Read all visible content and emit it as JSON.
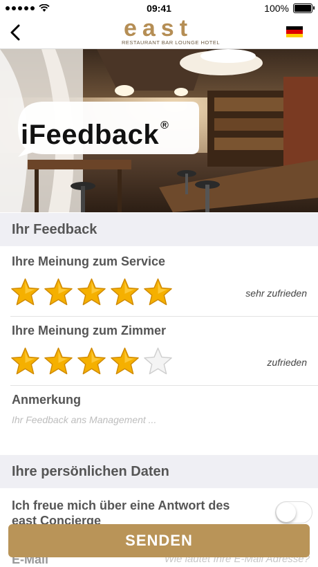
{
  "status": {
    "time": "09:41",
    "battery": "100%",
    "battery_level": 1.0
  },
  "header": {
    "logo_text": "east",
    "logo_subtitle": "RESTAURANT BAR LOUNGE HOTEL"
  },
  "hero": {
    "badge_text": "iFeedback",
    "badge_mark": "®"
  },
  "feedback_section": {
    "title": "Ihr Feedback"
  },
  "service": {
    "label": "Ihre Meinung zum Service",
    "rating": 5,
    "max": 5,
    "rating_text": "sehr zufrieden"
  },
  "room": {
    "label": "Ihre Meinung zum Zimmer",
    "rating": 4,
    "max": 5,
    "rating_text": "zufrieden"
  },
  "note": {
    "label": "Anmerkung",
    "placeholder": "Ihr Feedback ans Management ..."
  },
  "personal_section": {
    "title": "Ihre persönlichen Daten"
  },
  "concierge": {
    "label": "Ich freue mich über eine Antwort des east Concierge",
    "toggle_on": false
  },
  "email": {
    "label": "E-Mail",
    "placeholder": "Wie lautet Ihre E-Mail Adresse?"
  },
  "send_button": {
    "label": "SENDEN"
  },
  "colors": {
    "accent": "#b99458",
    "star": "#f5b000",
    "section_bg": "#efeff4"
  }
}
